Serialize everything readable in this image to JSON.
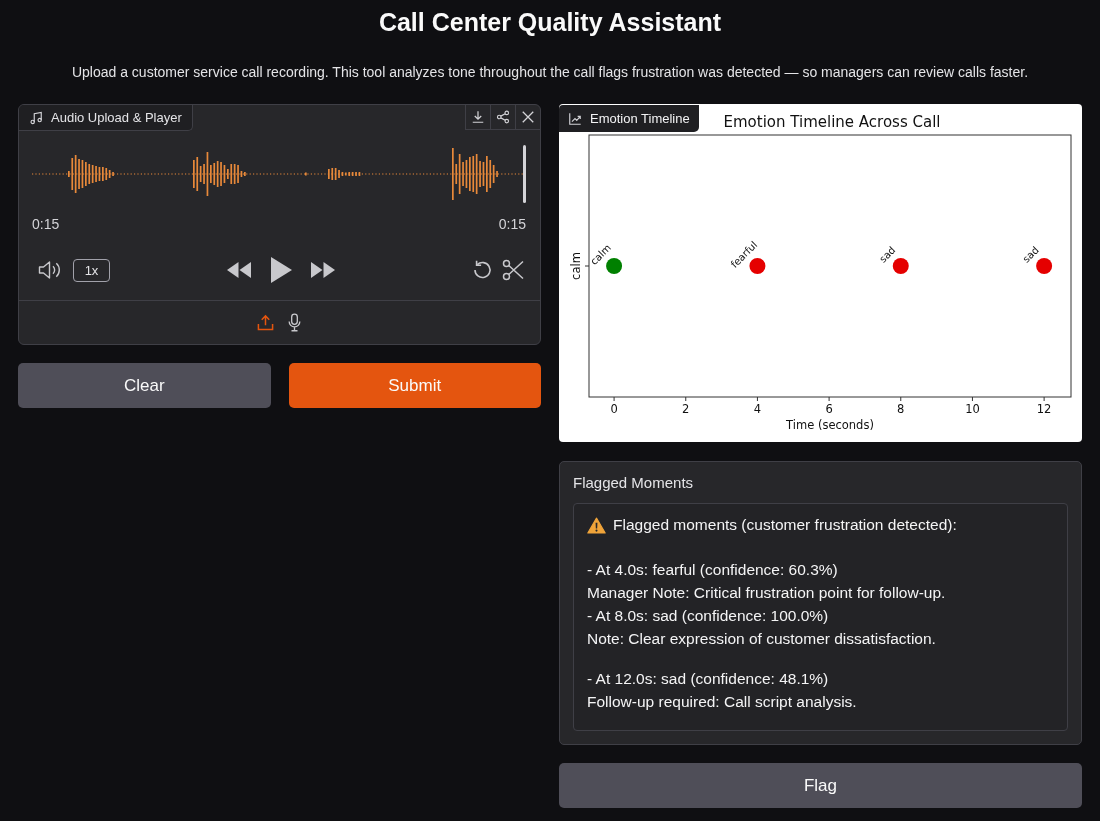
{
  "title": "Call Center Quality Assistant",
  "description": "Upload a customer service call recording. This tool analyzes tone throughout the call flags frustration was detected — so managers can review calls faster.",
  "audio": {
    "label": "Audio Upload & Player",
    "level": 1,
    "current_time": "0:15",
    "duration": "0:15",
    "speed": "1x"
  },
  "actions": [
    {
      "label": "Clear",
      "kind": "secondary"
    },
    {
      "label": "Submit",
      "kind": "primary"
    }
  ],
  "plot": {
    "label": "Emotion Timeline",
    "title": "Emotion Timeline Across Call",
    "xlabel": "Time (seconds)",
    "ylabel": "calm",
    "x_tick_labels": [
      "0",
      "2",
      "4",
      "6",
      "8",
      "10",
      "12"
    ],
    "points": [
      {
        "label": "calm",
        "color": "#008000"
      },
      {
        "label": "fearful",
        "color": "#e50000"
      },
      {
        "label": "sad",
        "color": "#e50000"
      },
      {
        "label": "sad",
        "color": "#e50000"
      }
    ]
  },
  "flagged": {
    "label": "Flagged Moments",
    "heading": "Flagged moments (customer frustration detected):",
    "paragraphs": [
      [
        "- At 4.0s: fearful (confidence: 60.3%)",
        "Manager Note: Critical frustration point for follow-up.",
        "- At 8.0s: sad (confidence: 100.0%)",
        "Note: Clear expression of customer dissatisfaction."
      ],
      [
        "- At 12.0s: sad (confidence: 48.1%)",
        "Follow-up required: Call script analysis."
      ]
    ]
  },
  "flag_button": {
    "label": "Flag"
  }
}
